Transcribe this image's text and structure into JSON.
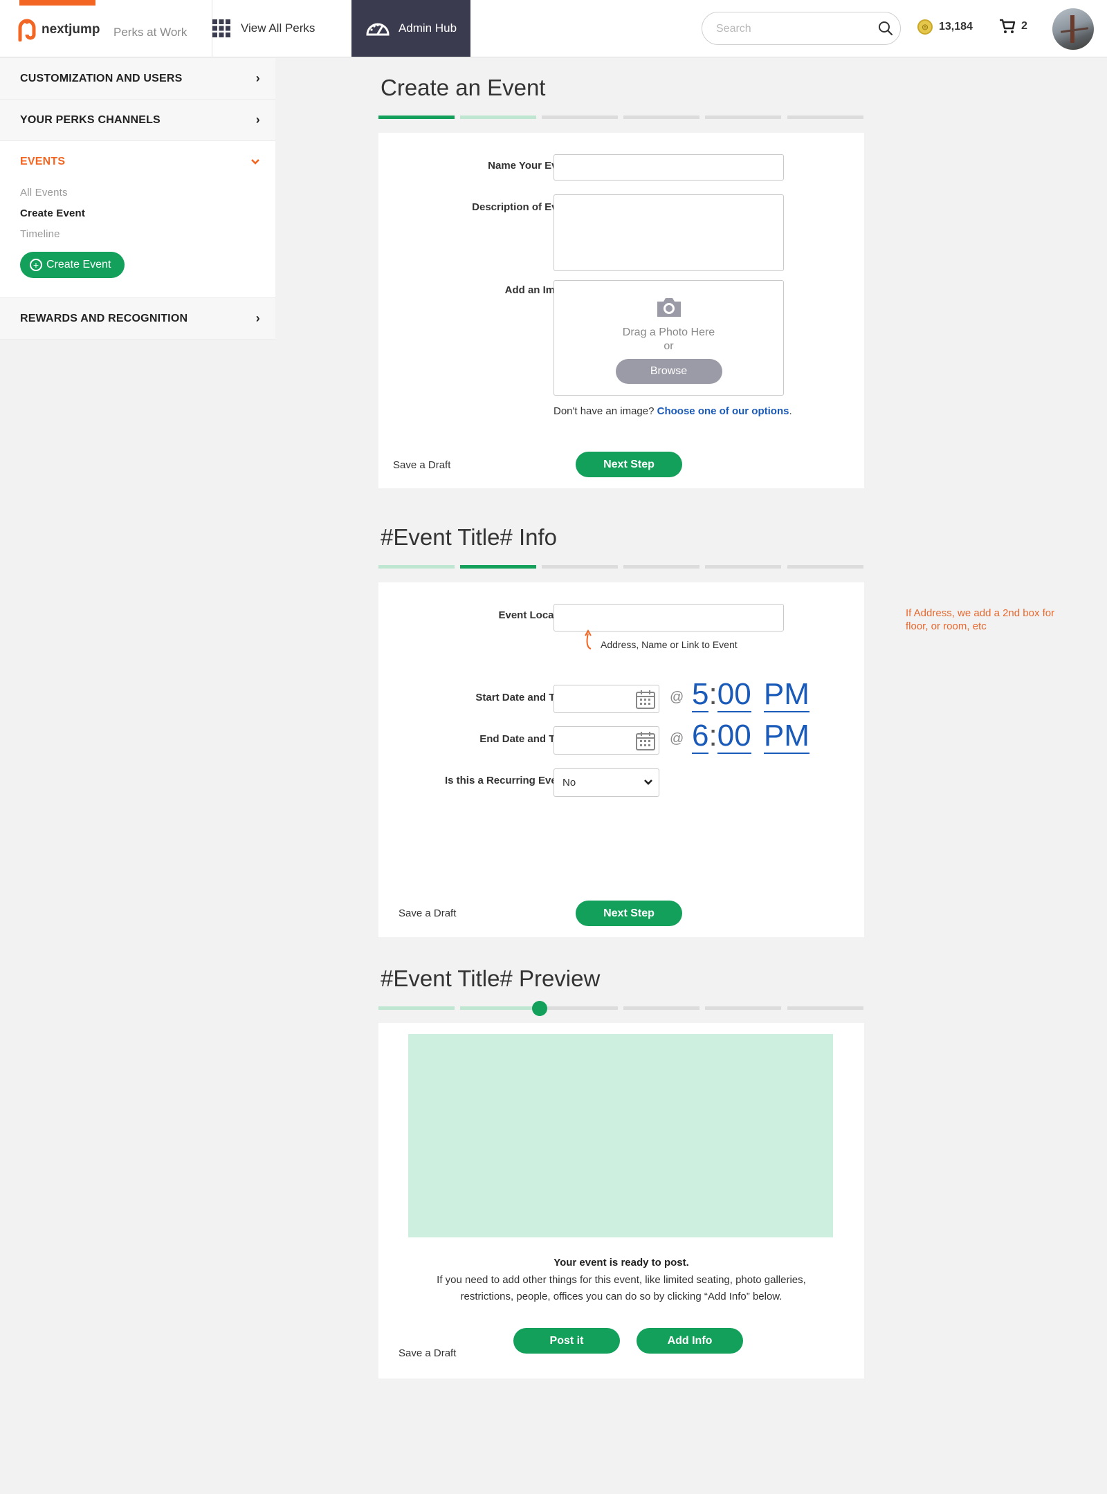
{
  "header": {
    "brand": "nextjump",
    "tagline": "Perks at Work",
    "view_all": "View All Perks",
    "admin_hub": "Admin Hub",
    "search_placeholder": "Search",
    "points": "13,184",
    "cart_count": "2"
  },
  "sidebar": {
    "sections": [
      {
        "label": "CUSTOMIZATION AND USERS"
      },
      {
        "label": "YOUR PERKS CHANNELS"
      }
    ],
    "events": {
      "label": "EVENTS",
      "items": [
        {
          "label": "All Events",
          "active": false
        },
        {
          "label": "Create Event",
          "active": true
        },
        {
          "label": "Timeline",
          "active": false
        }
      ],
      "create_button": "Create Event"
    },
    "rewards": {
      "label": "REWARDS AND RECOGNITION"
    }
  },
  "step1": {
    "title": "Create an Event",
    "name_label": "Name Your Event",
    "desc_label": "Description of Event",
    "image_label": "Add an Image",
    "drag_text": "Drag a Photo Here",
    "or_text": "or",
    "browse": "Browse",
    "no_image": "Don't have an image?",
    "choose_link": "Choose one of our options",
    "period": ".",
    "save_draft": "Save a Draft",
    "next": "Next Step"
  },
  "step2": {
    "title": "#Event Title# Info",
    "location_label": "Event Location",
    "location_hint": "Address, Name or Link to Event",
    "start_label": "Start Date and Time",
    "end_label": "End Date and Time",
    "recurring_label": "Is this a Recurring Event?",
    "at": "@",
    "start_hour": "5",
    "start_min": "00",
    "start_ampm": "PM",
    "end_hour": "6",
    "end_min": "00",
    "end_ampm": "PM",
    "colon": ":",
    "recurring_value": "No",
    "save_draft": "Save a Draft",
    "next": "Next Step"
  },
  "annotation": "If Address, we add a 2nd box for floor, or room, etc",
  "step3": {
    "title": "#Event Title# Preview",
    "ready_title": "Your event is ready to post.",
    "ready_body": "If you need to add other things for this event, like limited seating, photo galleries, restrictions, people, offices you can do so by clicking “Add Info” below.",
    "save_draft": "Save a Draft",
    "post": "Post it",
    "add_info": "Add Info"
  },
  "colors": {
    "accent_orange": "#f26522",
    "primary_green": "#13a05a",
    "light_green": "#ccefdf",
    "link_blue": "#1a5ab8",
    "admin_dark": "#3b3b4f"
  },
  "icons": [
    "nextjump-logo-icon",
    "grid-icon",
    "dashboard-icon",
    "search-icon",
    "coin-icon",
    "cart-icon",
    "chevron-right-icon",
    "chevron-down-icon",
    "plus-circle-icon",
    "camera-icon",
    "calendar-icon",
    "arrow-up-icon",
    "caret-down-icon"
  ]
}
